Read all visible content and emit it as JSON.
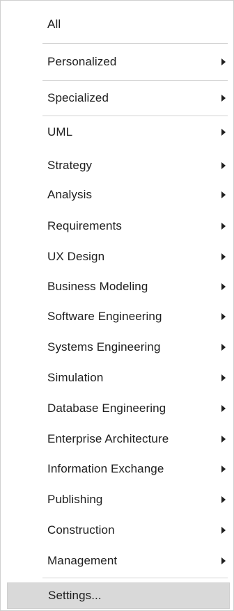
{
  "menu": {
    "items": [
      {
        "label": "All",
        "submenu": false
      },
      {
        "label": "Personalized",
        "submenu": true
      },
      {
        "label": "Specialized",
        "submenu": true
      },
      {
        "label": "UML",
        "submenu": true
      },
      {
        "label": "Strategy",
        "submenu": true
      },
      {
        "label": "Analysis",
        "submenu": true
      },
      {
        "label": "Requirements",
        "submenu": true
      },
      {
        "label": "UX Design",
        "submenu": true
      },
      {
        "label": "Business Modeling",
        "submenu": true
      },
      {
        "label": "Software Engineering",
        "submenu": true
      },
      {
        "label": "Systems Engineering",
        "submenu": true
      },
      {
        "label": "Simulation",
        "submenu": true
      },
      {
        "label": "Database Engineering",
        "submenu": true
      },
      {
        "label": "Enterprise Architecture",
        "submenu": true
      },
      {
        "label": "Information Exchange",
        "submenu": true
      },
      {
        "label": "Publishing",
        "submenu": true
      },
      {
        "label": "Construction",
        "submenu": true
      },
      {
        "label": "Management",
        "submenu": true
      },
      {
        "label": "Settings...",
        "submenu": false,
        "highlighted": true
      }
    ]
  }
}
